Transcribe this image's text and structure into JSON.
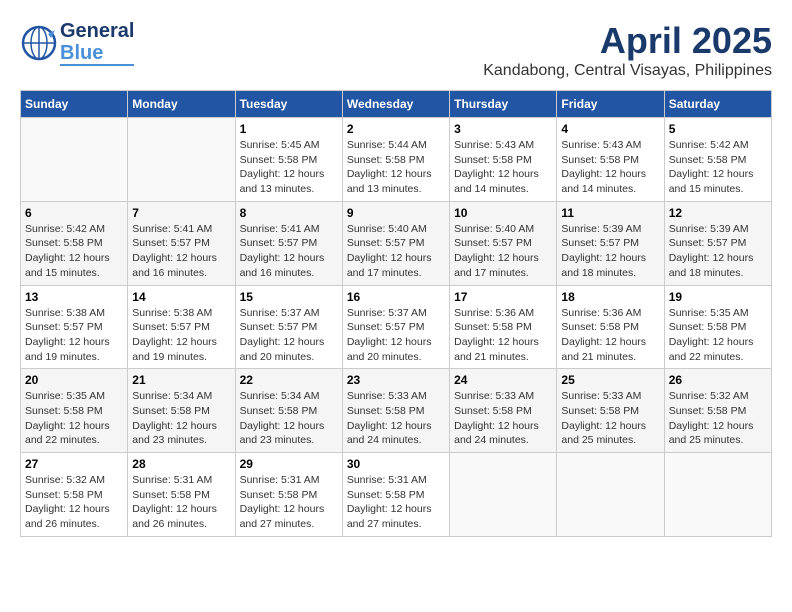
{
  "header": {
    "logo_line1": "General",
    "logo_line2": "Blue",
    "month": "April 2025",
    "location": "Kandabong, Central Visayas, Philippines"
  },
  "weekdays": [
    "Sunday",
    "Monday",
    "Tuesday",
    "Wednesday",
    "Thursday",
    "Friday",
    "Saturday"
  ],
  "weeks": [
    [
      {
        "day": "",
        "info": ""
      },
      {
        "day": "",
        "info": ""
      },
      {
        "day": "1",
        "info": "Sunrise: 5:45 AM\nSunset: 5:58 PM\nDaylight: 12 hours and 13 minutes."
      },
      {
        "day": "2",
        "info": "Sunrise: 5:44 AM\nSunset: 5:58 PM\nDaylight: 12 hours and 13 minutes."
      },
      {
        "day": "3",
        "info": "Sunrise: 5:43 AM\nSunset: 5:58 PM\nDaylight: 12 hours and 14 minutes."
      },
      {
        "day": "4",
        "info": "Sunrise: 5:43 AM\nSunset: 5:58 PM\nDaylight: 12 hours and 14 minutes."
      },
      {
        "day": "5",
        "info": "Sunrise: 5:42 AM\nSunset: 5:58 PM\nDaylight: 12 hours and 15 minutes."
      }
    ],
    [
      {
        "day": "6",
        "info": "Sunrise: 5:42 AM\nSunset: 5:58 PM\nDaylight: 12 hours and 15 minutes."
      },
      {
        "day": "7",
        "info": "Sunrise: 5:41 AM\nSunset: 5:57 PM\nDaylight: 12 hours and 16 minutes."
      },
      {
        "day": "8",
        "info": "Sunrise: 5:41 AM\nSunset: 5:57 PM\nDaylight: 12 hours and 16 minutes."
      },
      {
        "day": "9",
        "info": "Sunrise: 5:40 AM\nSunset: 5:57 PM\nDaylight: 12 hours and 17 minutes."
      },
      {
        "day": "10",
        "info": "Sunrise: 5:40 AM\nSunset: 5:57 PM\nDaylight: 12 hours and 17 minutes."
      },
      {
        "day": "11",
        "info": "Sunrise: 5:39 AM\nSunset: 5:57 PM\nDaylight: 12 hours and 18 minutes."
      },
      {
        "day": "12",
        "info": "Sunrise: 5:39 AM\nSunset: 5:57 PM\nDaylight: 12 hours and 18 minutes."
      }
    ],
    [
      {
        "day": "13",
        "info": "Sunrise: 5:38 AM\nSunset: 5:57 PM\nDaylight: 12 hours and 19 minutes."
      },
      {
        "day": "14",
        "info": "Sunrise: 5:38 AM\nSunset: 5:57 PM\nDaylight: 12 hours and 19 minutes."
      },
      {
        "day": "15",
        "info": "Sunrise: 5:37 AM\nSunset: 5:57 PM\nDaylight: 12 hours and 20 minutes."
      },
      {
        "day": "16",
        "info": "Sunrise: 5:37 AM\nSunset: 5:57 PM\nDaylight: 12 hours and 20 minutes."
      },
      {
        "day": "17",
        "info": "Sunrise: 5:36 AM\nSunset: 5:58 PM\nDaylight: 12 hours and 21 minutes."
      },
      {
        "day": "18",
        "info": "Sunrise: 5:36 AM\nSunset: 5:58 PM\nDaylight: 12 hours and 21 minutes."
      },
      {
        "day": "19",
        "info": "Sunrise: 5:35 AM\nSunset: 5:58 PM\nDaylight: 12 hours and 22 minutes."
      }
    ],
    [
      {
        "day": "20",
        "info": "Sunrise: 5:35 AM\nSunset: 5:58 PM\nDaylight: 12 hours and 22 minutes."
      },
      {
        "day": "21",
        "info": "Sunrise: 5:34 AM\nSunset: 5:58 PM\nDaylight: 12 hours and 23 minutes."
      },
      {
        "day": "22",
        "info": "Sunrise: 5:34 AM\nSunset: 5:58 PM\nDaylight: 12 hours and 23 minutes."
      },
      {
        "day": "23",
        "info": "Sunrise: 5:33 AM\nSunset: 5:58 PM\nDaylight: 12 hours and 24 minutes."
      },
      {
        "day": "24",
        "info": "Sunrise: 5:33 AM\nSunset: 5:58 PM\nDaylight: 12 hours and 24 minutes."
      },
      {
        "day": "25",
        "info": "Sunrise: 5:33 AM\nSunset: 5:58 PM\nDaylight: 12 hours and 25 minutes."
      },
      {
        "day": "26",
        "info": "Sunrise: 5:32 AM\nSunset: 5:58 PM\nDaylight: 12 hours and 25 minutes."
      }
    ],
    [
      {
        "day": "27",
        "info": "Sunrise: 5:32 AM\nSunset: 5:58 PM\nDaylight: 12 hours and 26 minutes."
      },
      {
        "day": "28",
        "info": "Sunrise: 5:31 AM\nSunset: 5:58 PM\nDaylight: 12 hours and 26 minutes."
      },
      {
        "day": "29",
        "info": "Sunrise: 5:31 AM\nSunset: 5:58 PM\nDaylight: 12 hours and 27 minutes."
      },
      {
        "day": "30",
        "info": "Sunrise: 5:31 AM\nSunset: 5:58 PM\nDaylight: 12 hours and 27 minutes."
      },
      {
        "day": "",
        "info": ""
      },
      {
        "day": "",
        "info": ""
      },
      {
        "day": "",
        "info": ""
      }
    ]
  ]
}
